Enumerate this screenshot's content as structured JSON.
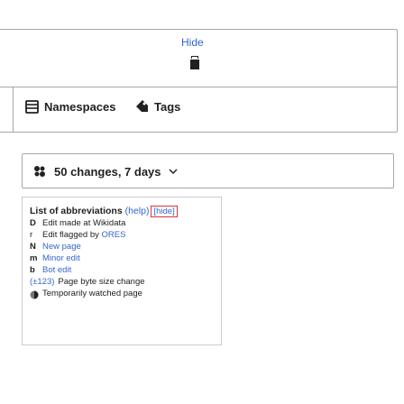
{
  "top_panel": {
    "hide_label": "Hide"
  },
  "filter_tabs": [
    {
      "label": "Namespaces",
      "icon": "namespaces-icon"
    },
    {
      "label": "Tags",
      "icon": "tag-icon"
    }
  ],
  "saved_settings": {
    "label": "50 changes, 7 days",
    "icon": "settings-icon"
  },
  "legend": {
    "title": "List of abbreviations",
    "help_label": "(help)",
    "hide_label": "[hide]",
    "items": [
      {
        "symbol": "D",
        "text": "Edit made at Wikidata",
        "link": ""
      },
      {
        "symbol": "r",
        "text": "Edit flagged by ",
        "link": "ORES"
      },
      {
        "symbol": "N",
        "text": "",
        "link": "New page"
      },
      {
        "symbol": "m",
        "text": "",
        "link": "Minor edit"
      },
      {
        "symbol": "b",
        "text": "",
        "link": "Bot edit"
      }
    ],
    "byte_change": {
      "symbol": "(±123)",
      "text": "Page byte size change"
    },
    "temp_watch": {
      "text": "Temporarily watched page"
    }
  },
  "colors": {
    "border": "#a2a9b1",
    "link": "#3366cc",
    "text": "#202122"
  }
}
